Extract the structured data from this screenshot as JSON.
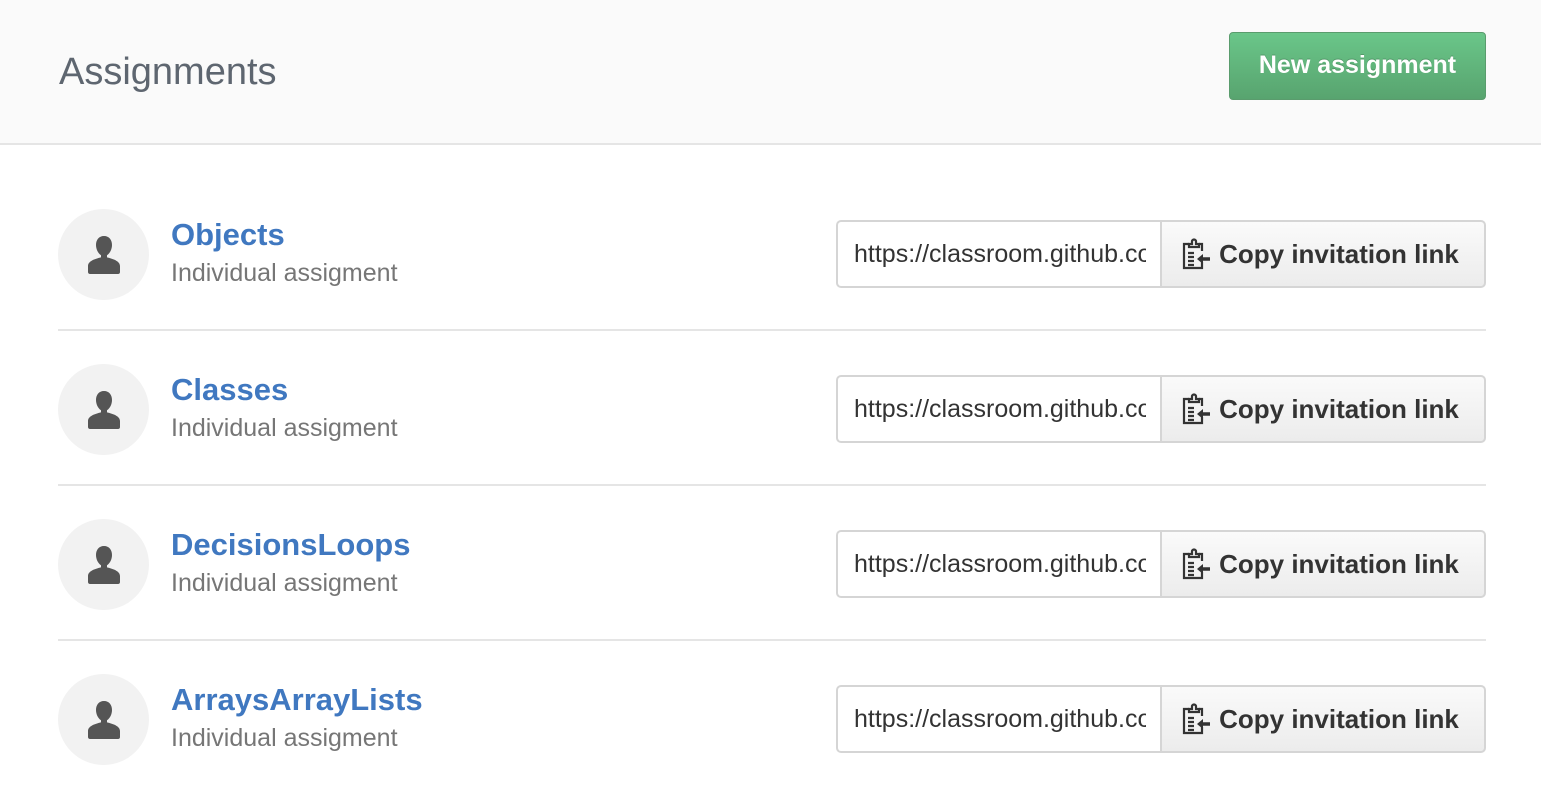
{
  "header": {
    "title": "Assignments",
    "new_button_label": "New assignment"
  },
  "colors": {
    "link": "#4078c0",
    "primary_button": "#5fb97c",
    "muted_text": "#767676"
  },
  "assignments": [
    {
      "name": "Objects",
      "type": "Individual assigment",
      "avatar_icon": "person-icon",
      "invitation_url": "https://classroom.github.com",
      "copy_label": "Copy invitation link",
      "copy_icon": "clipboard-icon"
    },
    {
      "name": "Classes",
      "type": "Individual assigment",
      "avatar_icon": "person-icon",
      "invitation_url": "https://classroom.github.com",
      "copy_label": "Copy invitation link",
      "copy_icon": "clipboard-icon"
    },
    {
      "name": "DecisionsLoops",
      "type": "Individual assigment",
      "avatar_icon": "person-icon",
      "invitation_url": "https://classroom.github.com",
      "copy_label": "Copy invitation link",
      "copy_icon": "clipboard-icon"
    },
    {
      "name": "ArraysArrayLists",
      "type": "Individual assigment",
      "avatar_icon": "person-icon",
      "invitation_url": "https://classroom.github.com",
      "copy_label": "Copy invitation link",
      "copy_icon": "clipboard-icon"
    }
  ]
}
